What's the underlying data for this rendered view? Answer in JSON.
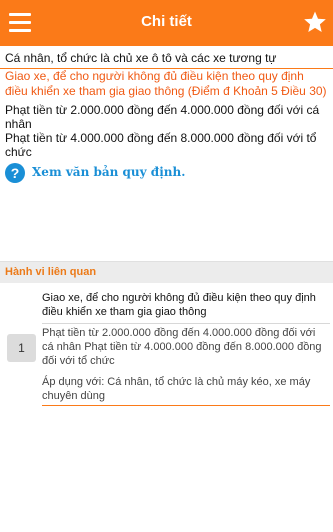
{
  "appbar": {
    "title": "Chi tiết",
    "menu_icon": "hamburger-icon",
    "favorite_icon": "star-icon"
  },
  "detail": {
    "subject": "Cá nhân, tổ chức là chủ xe ô tô và các xe tương tự",
    "violation": "Giao xe, để cho người không đủ điều kiện theo quy định điều khiển xe tham gia giao thông (Điểm đ Khoản 5 Điều 30)",
    "penalty_individual": "Phạt tiền từ 2.000.000 đồng đến 4.000.000 đồng đối với cá nhân",
    "penalty_organization": "Phạt tiền từ 4.000.000 đồng đến 8.000.000 đồng đối với tổ chức",
    "view_document_link": "Xem văn bản quy định.",
    "help_icon": "question-icon"
  },
  "related": {
    "header": "Hành vi liên quan",
    "items": [
      {
        "index": "1",
        "title": "Giao xe, để cho người không đủ điều kiện theo quy định điều khiển xe tham gia giao thông",
        "penalty": "Phạt tiền từ 2.000.000 đồng đến 4.000.000 đồng đối với cá nhân Phạt tiền từ 4.000.000 đồng đến 8.000.000 đồng đối với tổ chức",
        "applies_to": "Áp dụng với: Cá nhân, tổ chức là chủ máy kéo, xe máy chuyên dùng"
      }
    ]
  },
  "colors": {
    "accent": "#fb7a18",
    "violation_text": "#f05a14",
    "link": "#1a8fd6"
  }
}
